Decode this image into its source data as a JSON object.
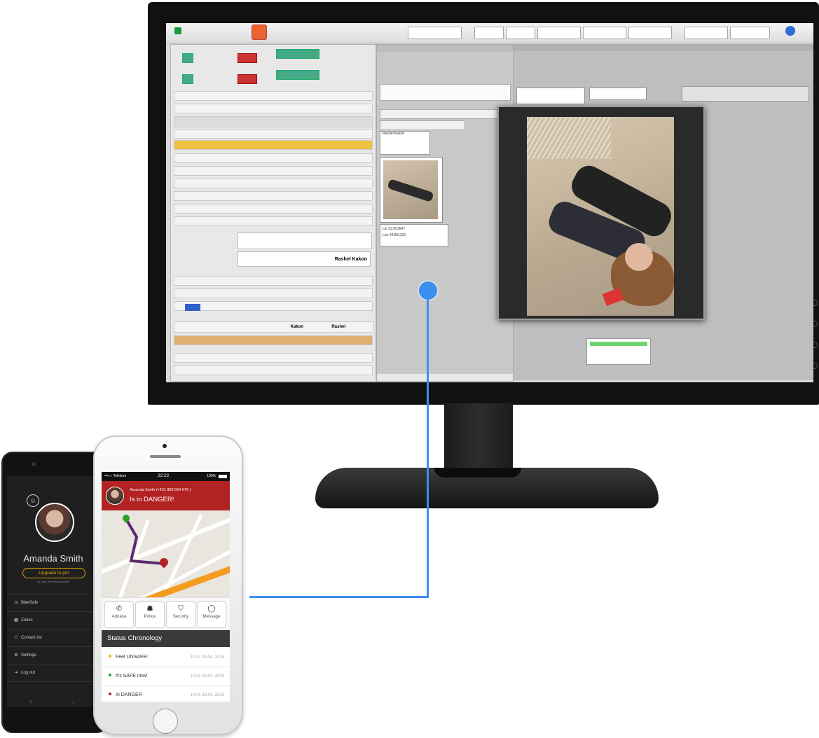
{
  "colors": {
    "accent": "#3a8ff0",
    "danger": "#b32222",
    "safe": "#2aa02a",
    "warn": "#f2b500",
    "upgrade": "#e0a800"
  },
  "dispatch": {
    "patient_name": "Rashel Kakon",
    "first_name": "Rashel",
    "last_name": "Kakon",
    "thumb_label": "Rashel Kakon",
    "lat_label": "Lat 32.051647",
    "lon_label": "Lon 34.861231"
  },
  "android": {
    "user_name": "Amanda Smith",
    "upgrade_label": "Upgrade to pro",
    "trial_note": "14 days free trial activated",
    "menu": [
      {
        "icon": "clock-icon",
        "label": "BleeSafe"
      },
      {
        "icon": "zones-icon",
        "label": "Zones"
      },
      {
        "icon": "contacts-icon",
        "label": "Contact list"
      },
      {
        "icon": "gear-icon",
        "label": "Settings"
      },
      {
        "icon": "logout-icon",
        "label": "Log out"
      }
    ]
  },
  "iphone": {
    "carrier": "•••○○ Telekom",
    "time": "22:22",
    "battery": "100%",
    "alert_contact": "Amanda Smith (+421 999 564 676 )",
    "alert_status": "Is in DANGER!",
    "actions": [
      {
        "icon": "phone-icon",
        "label": "Adriana"
      },
      {
        "icon": "police-icon",
        "label": "Police"
      },
      {
        "icon": "shield-icon",
        "label": "Security"
      },
      {
        "icon": "message-icon",
        "label": "Message"
      }
    ],
    "chrono_title": "Status Chronology",
    "events": [
      {
        "label": "Feel UNSAFE!",
        "time": "10:41 28.04. 2015",
        "color": "#f2b500"
      },
      {
        "label": "It's SAFE now!",
        "time": "10:41 28.04. 2015",
        "color": "#2aa02a"
      },
      {
        "label": "In DANGER",
        "time": "10:41 28.04. 2015",
        "color": "#b32222"
      }
    ]
  }
}
